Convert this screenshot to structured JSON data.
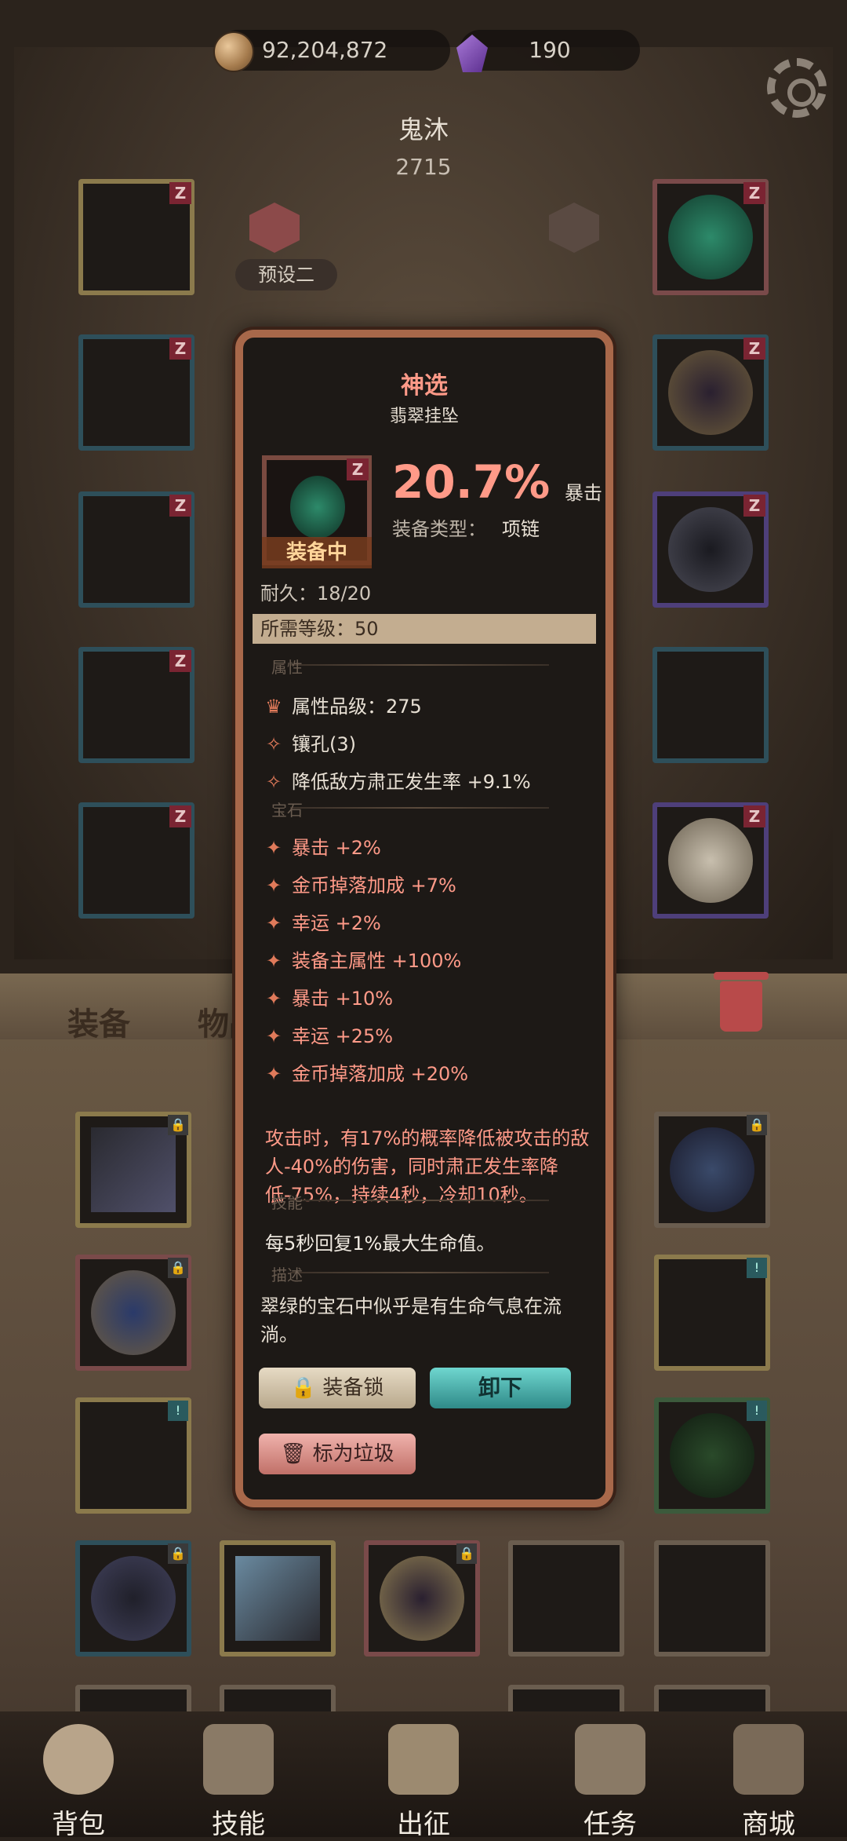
{
  "currency": {
    "gold": "92,204,872",
    "gems": "190"
  },
  "character": {
    "name": "鬼沐",
    "power": "2715"
  },
  "preset": {
    "label": "预设二"
  },
  "tabs": {
    "equip": "装备",
    "items": "物品"
  },
  "tooltip": {
    "title": "神选",
    "subtitle": "翡翠挂坠",
    "equipped_label": "装备中",
    "stat_value": "20.7%",
    "stat_name": "暴击",
    "type_label": "装备类型：",
    "type_value": "项链",
    "durability": "耐久：18/20",
    "required_level": "所需等级：50",
    "section_attributes": "属性",
    "attribute_grade": "属性品级：275",
    "sockets": "镶孔(3)",
    "reduce_stat": "降低敌方肃正发生率 +9.1%",
    "section_gems": "宝石",
    "gems": [
      "暴击 +2%",
      "金币掉落加成 +7%",
      "幸运 +2%",
      "装备主属性 +100%",
      "暴击 +10%",
      "幸运 +25%",
      "金币掉落加成 +20%"
    ],
    "effect": "攻击时，有17%的概率降低被攻击的敌人-40%的伤害，同时肃正发生率降低-75%，持续4秒，冷却10秒。",
    "section_skill": "技能",
    "skill": "每5秒回复1%最大生命值。",
    "section_desc": "描述",
    "description": "翠绿的宝石中似乎是有生命气息在流淌。"
  },
  "buttons": {
    "lock": "装备锁",
    "unequip": "卸下",
    "junk": "标为垃圾"
  },
  "nav": {
    "bag": "背包",
    "skills": "技能",
    "battle": "出征",
    "quests": "任务",
    "shop": "商城"
  },
  "colors": {
    "accent_red": "#ff9a88",
    "frame_copper": "#a8684a",
    "teal": "#2f8a88"
  }
}
